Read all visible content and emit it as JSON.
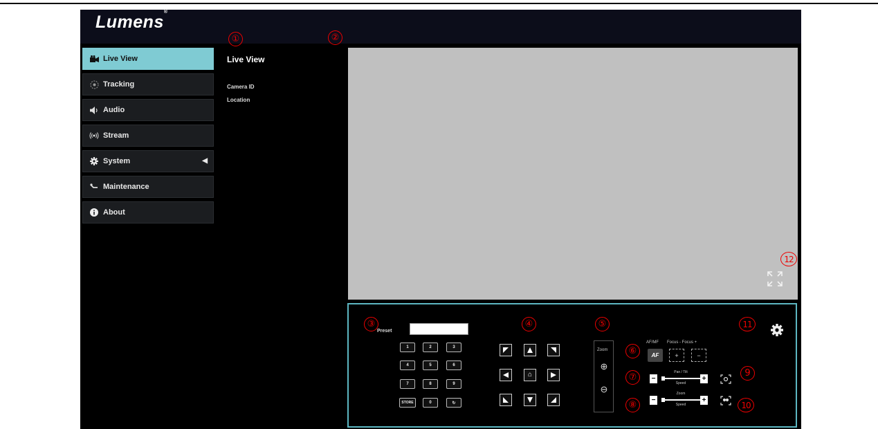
{
  "app": {
    "logo": "Lumens"
  },
  "sidebar": {
    "items": [
      {
        "label": "Live View",
        "icon": "camera-icon"
      },
      {
        "label": "Tracking",
        "icon": "tracking-icon"
      },
      {
        "label": "Audio",
        "icon": "speaker-icon"
      },
      {
        "label": "Stream",
        "icon": "broadcast-icon"
      },
      {
        "label": "System",
        "icon": "gear-icon",
        "caret": "◀"
      },
      {
        "label": "Maintenance",
        "icon": "wrench-icon"
      },
      {
        "label": "About",
        "icon": "info-icon"
      }
    ]
  },
  "info": {
    "title": "Live View",
    "camera_id_label": "Camera ID",
    "location_label": "Location"
  },
  "preset": {
    "label": "Preset",
    "value": "",
    "keys": [
      "1",
      "2",
      "3",
      "4",
      "5",
      "6",
      "7",
      "8",
      "9",
      "STORE",
      "0",
      "↻"
    ]
  },
  "ptz": {
    "home_glyph": "⌂"
  },
  "zoom": {
    "label": "Zoom",
    "in_glyph": "⊕",
    "out_glyph": "⊖"
  },
  "focus": {
    "afmf_label": "AF/MF",
    "focus_label": "Focus - Focus +",
    "af_button": "AF",
    "near_glyph": "+",
    "far_glyph": "−"
  },
  "pan_tilt_speed": {
    "label_top": "Pan / Tilt",
    "label_bottom": "Speed",
    "minus": "−",
    "plus": "+"
  },
  "zoom_speed": {
    "label_top": "Zoom",
    "label_bottom": "Speed",
    "minus": "−",
    "plus": "+"
  },
  "callouts": [
    "①",
    "②",
    "③",
    "④",
    "⑤",
    "⑥",
    "⑦",
    "⑧",
    "9",
    "10",
    "11",
    "12"
  ],
  "colors": {
    "accent": "#7fcbd3",
    "panel_border": "#5db7c2",
    "callout": "#e00000",
    "video_bg": "#c0c0c0"
  }
}
